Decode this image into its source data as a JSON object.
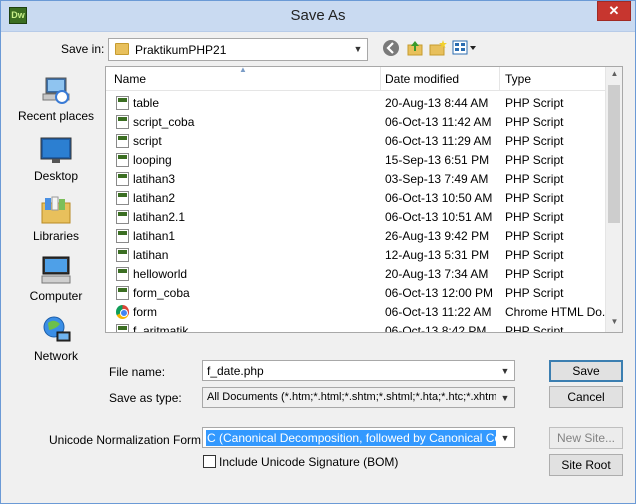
{
  "window": {
    "title": "Save As",
    "app_icon_text": "Dw",
    "close_label": "✕"
  },
  "toolbar": {
    "save_in_label": "Save in:",
    "save_in_value": "PraktikumPHP21",
    "icons": [
      "back-icon",
      "up-folder-icon",
      "new-folder-icon",
      "view-menu-icon"
    ]
  },
  "places": [
    {
      "label": "Recent places",
      "icon": "recent-places-icon"
    },
    {
      "label": "Desktop",
      "icon": "desktop-icon"
    },
    {
      "label": "Libraries",
      "icon": "libraries-icon"
    },
    {
      "label": "Computer",
      "icon": "computer-icon"
    },
    {
      "label": "Network",
      "icon": "network-icon"
    }
  ],
  "file_list": {
    "columns": [
      "Name",
      "Date modified",
      "Type"
    ],
    "rows": [
      {
        "name": "table",
        "date": "20-Aug-13 8:44 AM",
        "type": "PHP Script"
      },
      {
        "name": "script_coba",
        "date": "06-Oct-13 11:42 AM",
        "type": "PHP Script"
      },
      {
        "name": "script",
        "date": "06-Oct-13 11:29 AM",
        "type": "PHP Script"
      },
      {
        "name": "looping",
        "date": "15-Sep-13 6:51 PM",
        "type": "PHP Script"
      },
      {
        "name": "latihan3",
        "date": "03-Sep-13 7:49 AM",
        "type": "PHP Script"
      },
      {
        "name": "latihan2",
        "date": "06-Oct-13 10:50 AM",
        "type": "PHP Script"
      },
      {
        "name": "latihan2.1",
        "date": "06-Oct-13 10:51 AM",
        "type": "PHP Script"
      },
      {
        "name": "latihan1",
        "date": "26-Aug-13 9:42 PM",
        "type": "PHP Script"
      },
      {
        "name": "latihan",
        "date": "12-Aug-13 5:31 PM",
        "type": "PHP Script"
      },
      {
        "name": "helloworld",
        "date": "20-Aug-13 7:34 AM",
        "type": "PHP Script"
      },
      {
        "name": "form_coba",
        "date": "06-Oct-13 12:00 PM",
        "type": "PHP Script"
      },
      {
        "name": "form",
        "date": "06-Oct-13 11:22 AM",
        "type": "Chrome HTML Do..."
      },
      {
        "name": "f_aritmatik",
        "date": "06-Oct-13 8:42 PM",
        "type": "PHP Script"
      }
    ]
  },
  "form": {
    "file_name_label": "File name:",
    "file_name_value": "f_date.php",
    "save_type_label": "Save as type:",
    "save_type_value": "All Documents (*.htm;*.html;*.shtm;*.shtml;*.hta;*.htc;*.xhtml;*.s",
    "unicode_label": "Unicode Normalization Form:",
    "unicode_value": "C (Canonical Decomposition, followed by Canonical Composi",
    "bom_label": "Include Unicode Signature (BOM)"
  },
  "buttons": {
    "save": "Save",
    "cancel": "Cancel",
    "new_site": "New Site...",
    "site_root": "Site Root"
  }
}
